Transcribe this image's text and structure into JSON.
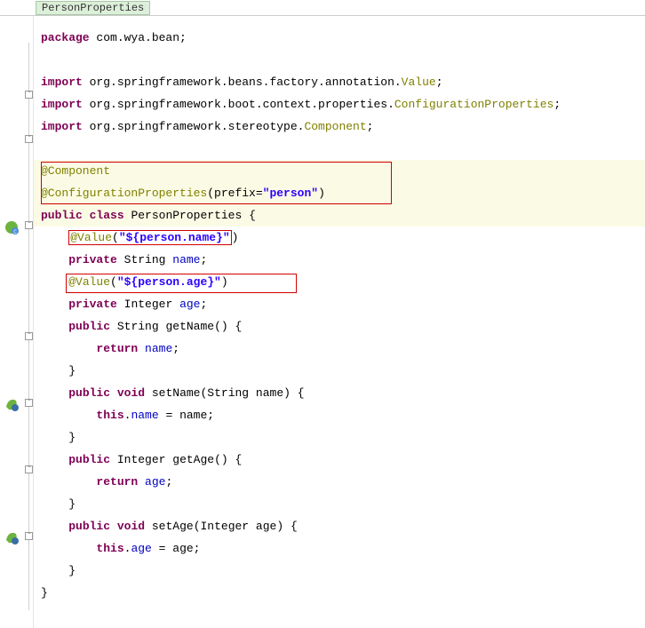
{
  "breadcrumb": {
    "label": "PersonProperties"
  },
  "code": {
    "pkg_kw": "package",
    "pkg_name": " com.wya.bean;",
    "imp_kw": "import",
    "imp1a": " org.springframework.beans.factory.annotation.",
    "imp1b": "Value",
    "imp1c": ";",
    "imp2a": " org.springframework.boot.context.properties.",
    "imp2b": "ConfigurationProperties",
    "imp2c": ";",
    "imp3a": " org.springframework.stereotype.",
    "imp3b": "Component",
    "imp3c": ";",
    "annot_component": "@Component",
    "annot_cfg": "@ConfigurationProperties",
    "cfg_prefix_a": "(prefix=",
    "cfg_prefix_str": "\"person\"",
    "cfg_prefix_b": ")",
    "public": "public",
    "class": "class",
    "void": "void",
    "private": "private",
    "return": "return",
    "this": "this",
    "class_name": "PersonProperties",
    "string_type": "String",
    "integer_type": "Integer",
    "annot_value": "@Value",
    "val_name_str": "\"${person.name}\"",
    "val_age_str": "\"${person.age}\"",
    "field_name": "name",
    "field_age": "age",
    "get_name": "getName",
    "set_name": "setName",
    "get_age": "getAge",
    "set_age": "setAge",
    "lbrace": " {",
    "rbrace": "}",
    "paren_open": "(",
    "paren_close": ")",
    "semi": ";",
    "eq": " = ",
    "dot": "."
  }
}
